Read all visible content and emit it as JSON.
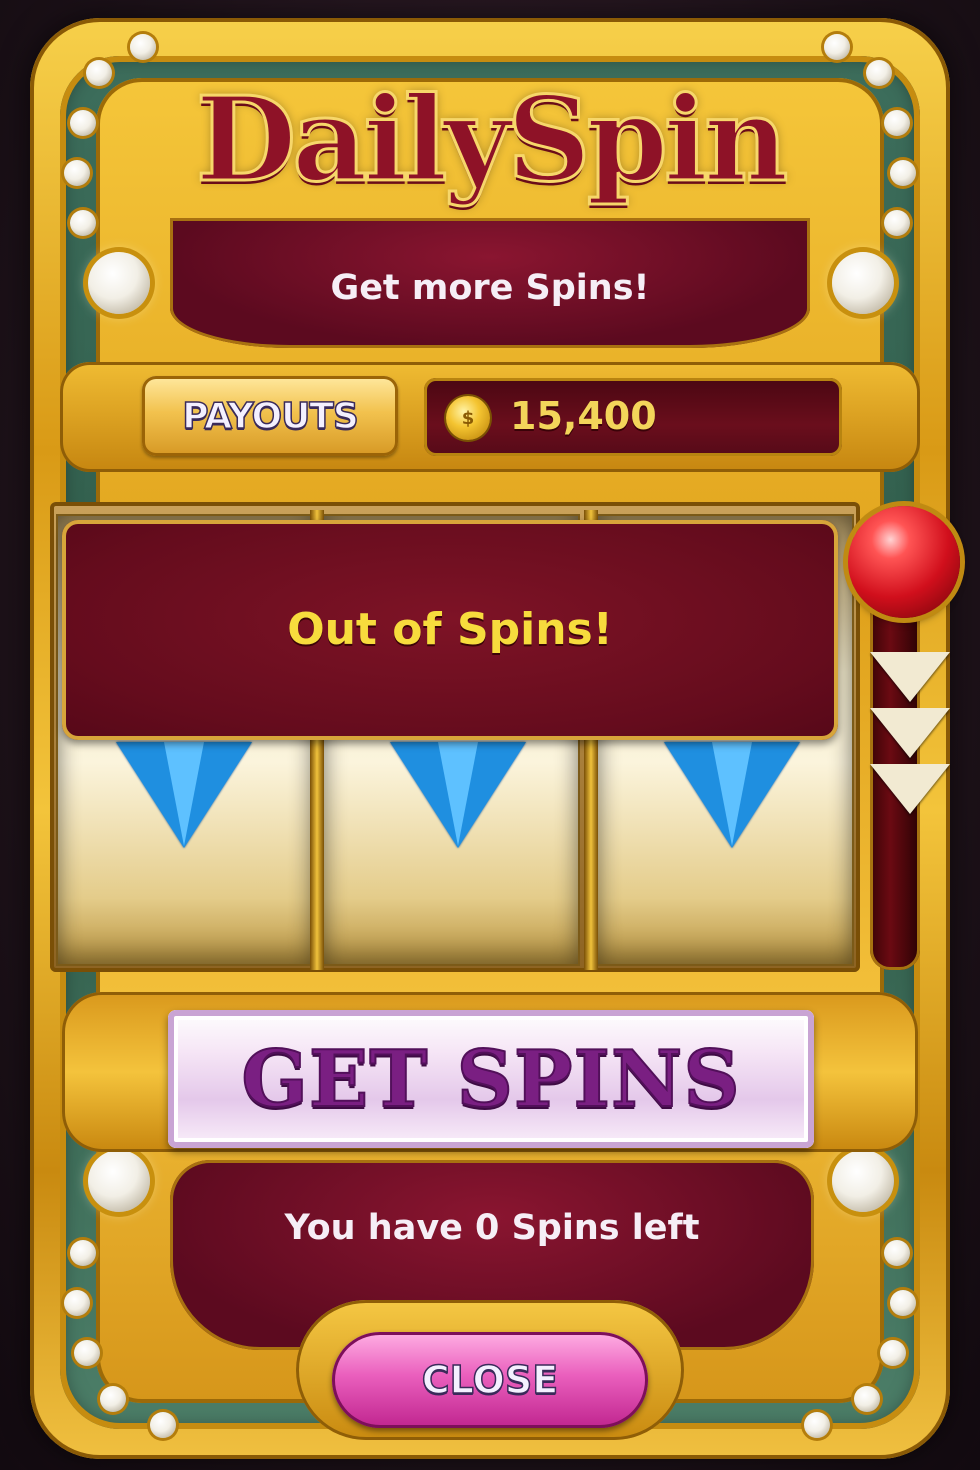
{
  "header": {
    "title": "DailySpin",
    "subtitle": "Get more Spins!"
  },
  "toolbar": {
    "payouts_label": "PAYOUTS",
    "coin_icon": "coin-icon",
    "coin_balance": "15,400"
  },
  "reels": {
    "symbols": [
      "blue-gem-icon",
      "blue-gem-icon",
      "blue-gem-icon"
    ],
    "overlay_message": "Out of Spins!"
  },
  "lever": {
    "icon": "lever-knob-icon",
    "arrows": [
      "chevron-down-icon",
      "chevron-down-icon",
      "chevron-down-icon"
    ]
  },
  "actions": {
    "get_spins_label": "GET SPINS",
    "spins_left_text": "You have 0 Spins left",
    "close_label": "CLOSE"
  },
  "colors": {
    "gold": "#f3c43b",
    "maroon": "#650c1d",
    "gem_blue": "#1f8fe0",
    "title_red": "#8e1227",
    "message_yellow": "#f7dc3d",
    "get_spins_purple": "#7a1f82",
    "close_pink": "#ea5fbd"
  }
}
